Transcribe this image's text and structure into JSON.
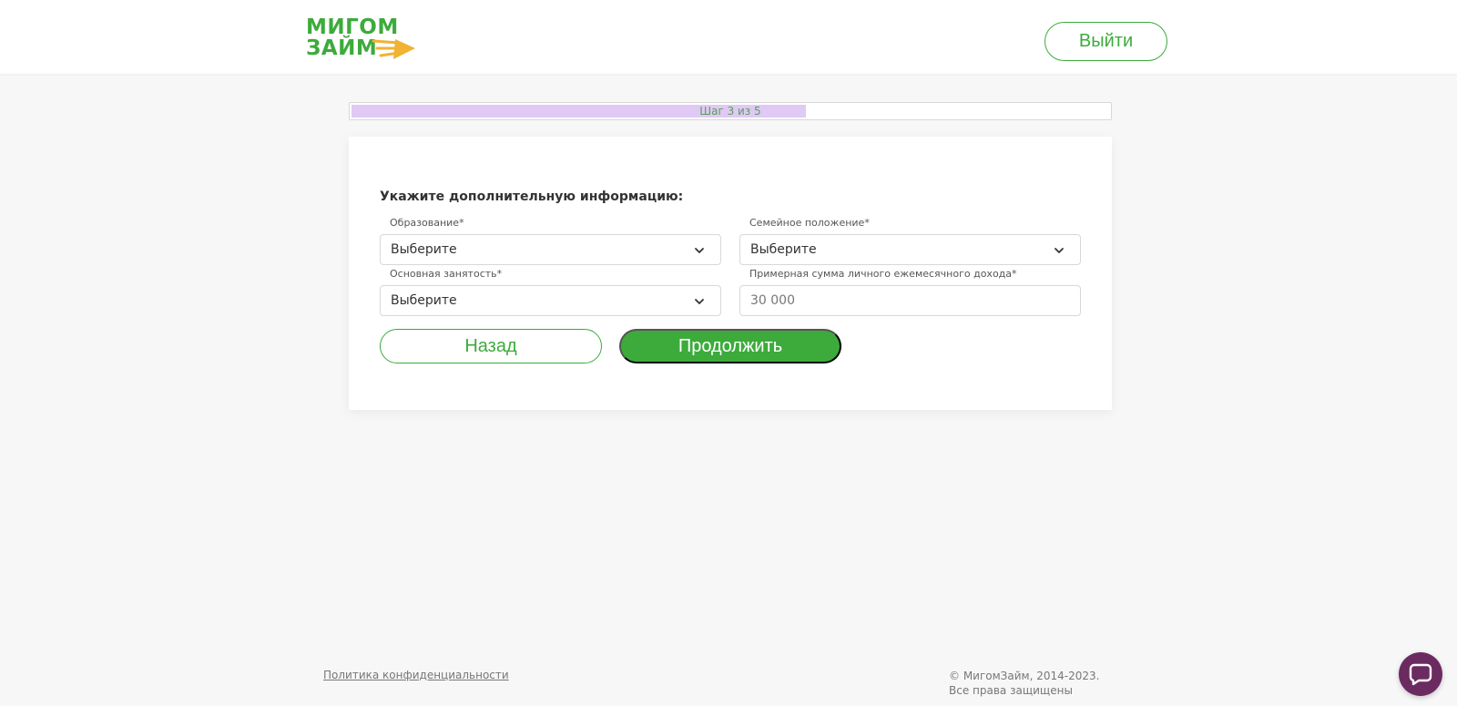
{
  "header": {
    "logo_text": "МИГОМ\nЗАЙМ",
    "logout_label": "Выйти"
  },
  "progress": {
    "label": "Шаг 3 из 5",
    "current_step": 3,
    "total_steps": 5
  },
  "form": {
    "title": "Укажите дополнительную информацию:",
    "education": {
      "label": "Образование*",
      "value": "Выберите"
    },
    "marital_status": {
      "label": "Семейное положение*",
      "value": "Выберите"
    },
    "employment": {
      "label": "Основная занятость*",
      "value": "Выберите"
    },
    "income": {
      "label": "Примерная сумма личного ежемесячного дохода*",
      "placeholder": "30 000"
    },
    "back_label": "Назад",
    "continue_label": "Продолжить"
  },
  "footer": {
    "privacy_link": "Политика конфиденциальности",
    "copyright": "© МигомЗайм, 2014-2023. Все права защищены"
  },
  "colors": {
    "brand_green": "#3cab3b",
    "progress_fill": "#e0c9f5",
    "chat_button": "#6b2b61"
  },
  "icons": {
    "logo_arrow": "logo-arrow-icon",
    "select_chevron": "chevron-down-icon",
    "chat": "chat-bubble-icon"
  }
}
